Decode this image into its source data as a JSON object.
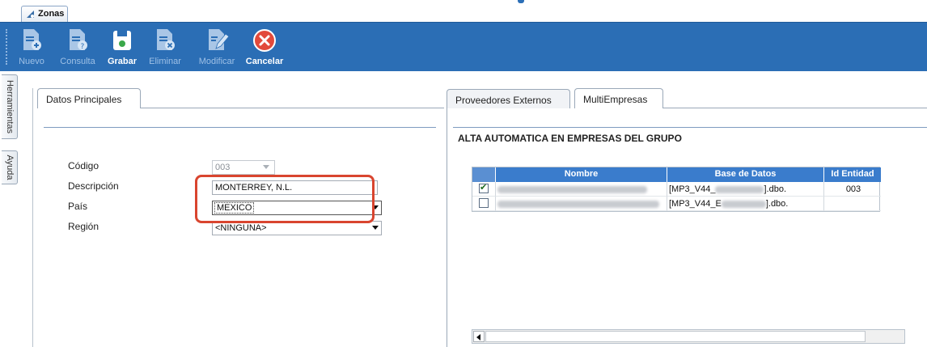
{
  "doc_tab": {
    "label": "Zonas"
  },
  "toolbar": {
    "buttons": [
      {
        "label": "Nuevo",
        "icon": "new-document-icon",
        "enabled": false
      },
      {
        "label": "Consulta",
        "icon": "query-document-icon",
        "enabled": false
      },
      {
        "label": "Grabar",
        "icon": "save-disk-icon",
        "enabled": true
      },
      {
        "label": "Eliminar",
        "icon": "delete-document-icon",
        "enabled": false
      },
      {
        "label": "Modificar",
        "icon": "edit-document-icon",
        "enabled": false
      },
      {
        "label": "Cancelar",
        "icon": "cancel-x-icon",
        "enabled": true
      }
    ]
  },
  "side_tabs": [
    "Herramientas",
    "Ayuda"
  ],
  "left": {
    "tab": "Datos Principales",
    "fields": {
      "codigo": {
        "label": "Código",
        "value": "003"
      },
      "descripcion": {
        "label": "Descripción",
        "value": "MONTERREY, N.L."
      },
      "pais": {
        "label": "País",
        "value": "MEXICO"
      },
      "region": {
        "label": "Región",
        "value": "<NINGUNA>"
      }
    }
  },
  "right": {
    "tabs": [
      "Proveedores Externos",
      "MultiEmpresas"
    ],
    "active_tab": "MultiEmpresas",
    "section_title": "ALTA AUTOMATICA EN EMPRESAS DEL GRUPO",
    "grid": {
      "columns": [
        "Nombre",
        "Base de Datos",
        "Id Entidad"
      ],
      "rows": [
        {
          "checked": true,
          "db_prefix": "[MP3_V44_",
          "db_suffix": "].dbo.",
          "id": "003"
        },
        {
          "checked": false,
          "db_prefix": "[MP3_V44_E",
          "db_suffix": "].dbo.",
          "id": ""
        }
      ]
    }
  },
  "colors": {
    "toolbar": "#2b6eb5",
    "grid_header": "#3a7ccc",
    "highlight": "#d9452f"
  }
}
